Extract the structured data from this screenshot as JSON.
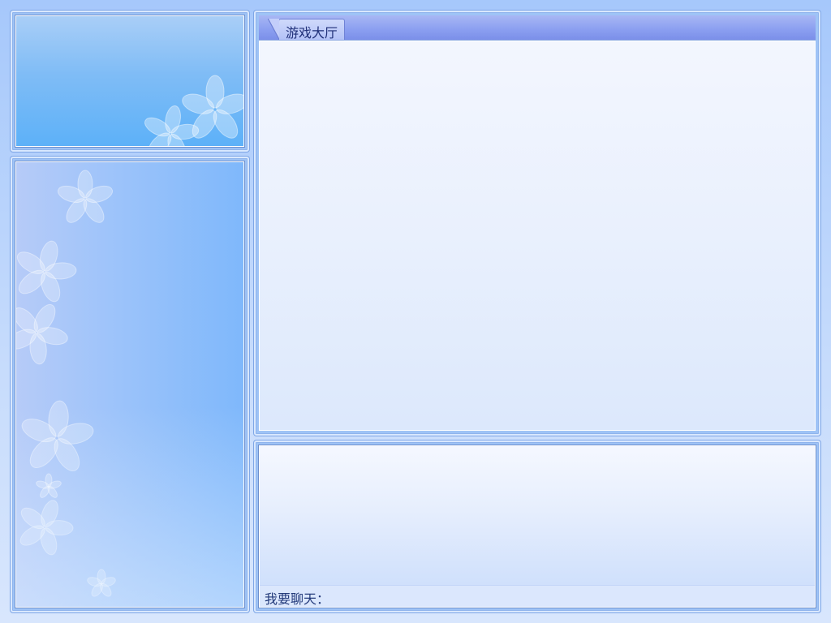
{
  "lobby": {
    "tab_label": "游戏大厅"
  },
  "chat": {
    "label": "我要聊天：",
    "input_value": ""
  },
  "decorations": {
    "avatar_panel": "flower-icon",
    "tree_panel": "flower-icon"
  }
}
